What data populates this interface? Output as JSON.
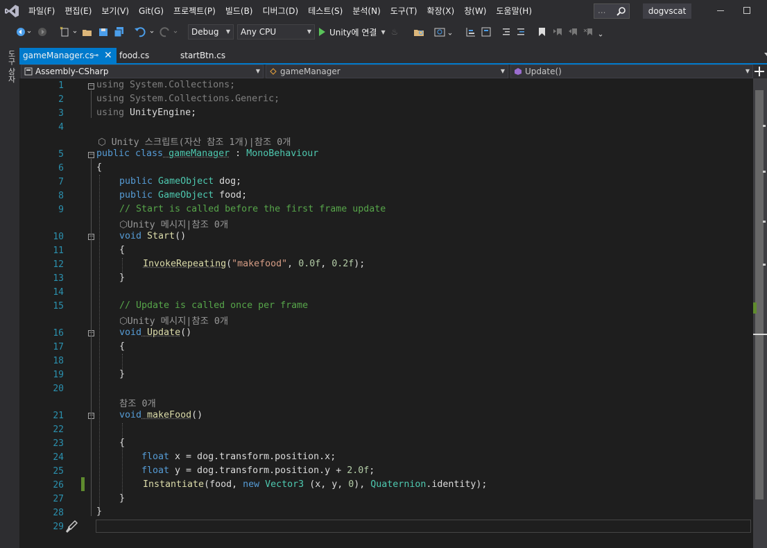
{
  "menu": [
    "파일(F)",
    "편집(E)",
    "보기(V)",
    "Git(G)",
    "프로젝트(P)",
    "빌드(B)",
    "디버그(D)",
    "테스트(S)",
    "분석(N)",
    "도구(T)",
    "확장(X)",
    "창(W)",
    "도움말(H)"
  ],
  "search": {
    "placeholder": "..."
  },
  "solution_name": "dogvscat",
  "toolbar": {
    "config": "Debug",
    "platform": "Any CPU",
    "run_label": "Unity에 연결"
  },
  "toolwindow_label": "도구 상자",
  "tabs": [
    {
      "label": "gameManager.cs",
      "pin": "⊸",
      "close": "✕"
    },
    {
      "label": "food.cs"
    },
    {
      "label": "startBtn.cs"
    }
  ],
  "navbar": {
    "project": "Assembly-CSharp",
    "class": "gameManager",
    "member": "Update()"
  },
  "codelens": {
    "class": "Unity 스크립트(자산 참조 1개)|참조 0개",
    "start": "Unity 메시지|참조 0개",
    "update": "Unity 메시지|참조 0개",
    "makefood": "참조 0개"
  },
  "line_numbers": [
    "1",
    "2",
    "3",
    "4",
    "5",
    "6",
    "7",
    "8",
    "9",
    "10",
    "11",
    "12",
    "13",
    "14",
    "15",
    "16",
    "17",
    "18",
    "19",
    "20",
    "21",
    "22",
    "23",
    "24",
    "25",
    "26",
    "27",
    "28",
    "29"
  ],
  "code": {
    "l1a": "using",
    "l1b": " System.Collections;",
    "l2a": "using",
    "l2b": " System.Collections.Generic;",
    "l3a": "using",
    "l3b": " UnityEngine;",
    "l5a": "public class",
    "l5b": " gameManager",
    "l5c": " : ",
    "l5d": "MonoBehaviour",
    "l6": "{",
    "l7a": "public",
    "l7b": " GameObject",
    "l7c": " dog;",
    "l8a": "public",
    "l8b": " GameObject",
    "l8c": " food;",
    "l9": "// Start is called before the first frame update",
    "l10a": "void",
    "l10b": " Start",
    "l10c": "()",
    "l11": "{",
    "l12a": "InvokeRepeating",
    "l12b": "(",
    "l12c": "\"makefood\"",
    "l12d": ", ",
    "l12e": "0.0f",
    "l12f": ", ",
    "l12g": "0.2f",
    "l12h": ");",
    "l13": "}",
    "l15": "// Update is called once per frame",
    "l16a": "void",
    "l16b": " Update",
    "l16c": "()",
    "l17": "{",
    "l19": "}",
    "l21a": "void",
    "l21b": " makeFood",
    "l21c": "()",
    "l23": "{",
    "l24a": "float",
    "l24b": " x = dog.transform.position.x;",
    "l25a": "float",
    "l25b": " y = dog.transform.position.y + ",
    "l25c": "2.0f",
    "l25d": ";",
    "l26a": "Instantiate",
    "l26b": "(food, ",
    "l26c": "new",
    "l26d": " Vector3",
    "l26e": " (x, y, ",
    "l26f": "0",
    "l26g": "), ",
    "l26h": "Quaternion",
    "l26i": ".identity);",
    "l27": "}",
    "l28": "}"
  },
  "colors": {
    "accent": "#007acc",
    "keyword": "#569cd6",
    "type": "#4ec9b0",
    "comment": "#57a64a",
    "string": "#d69d85",
    "number": "#b5cea8",
    "method": "#dcdcaa",
    "line_number": "#2b91af"
  }
}
